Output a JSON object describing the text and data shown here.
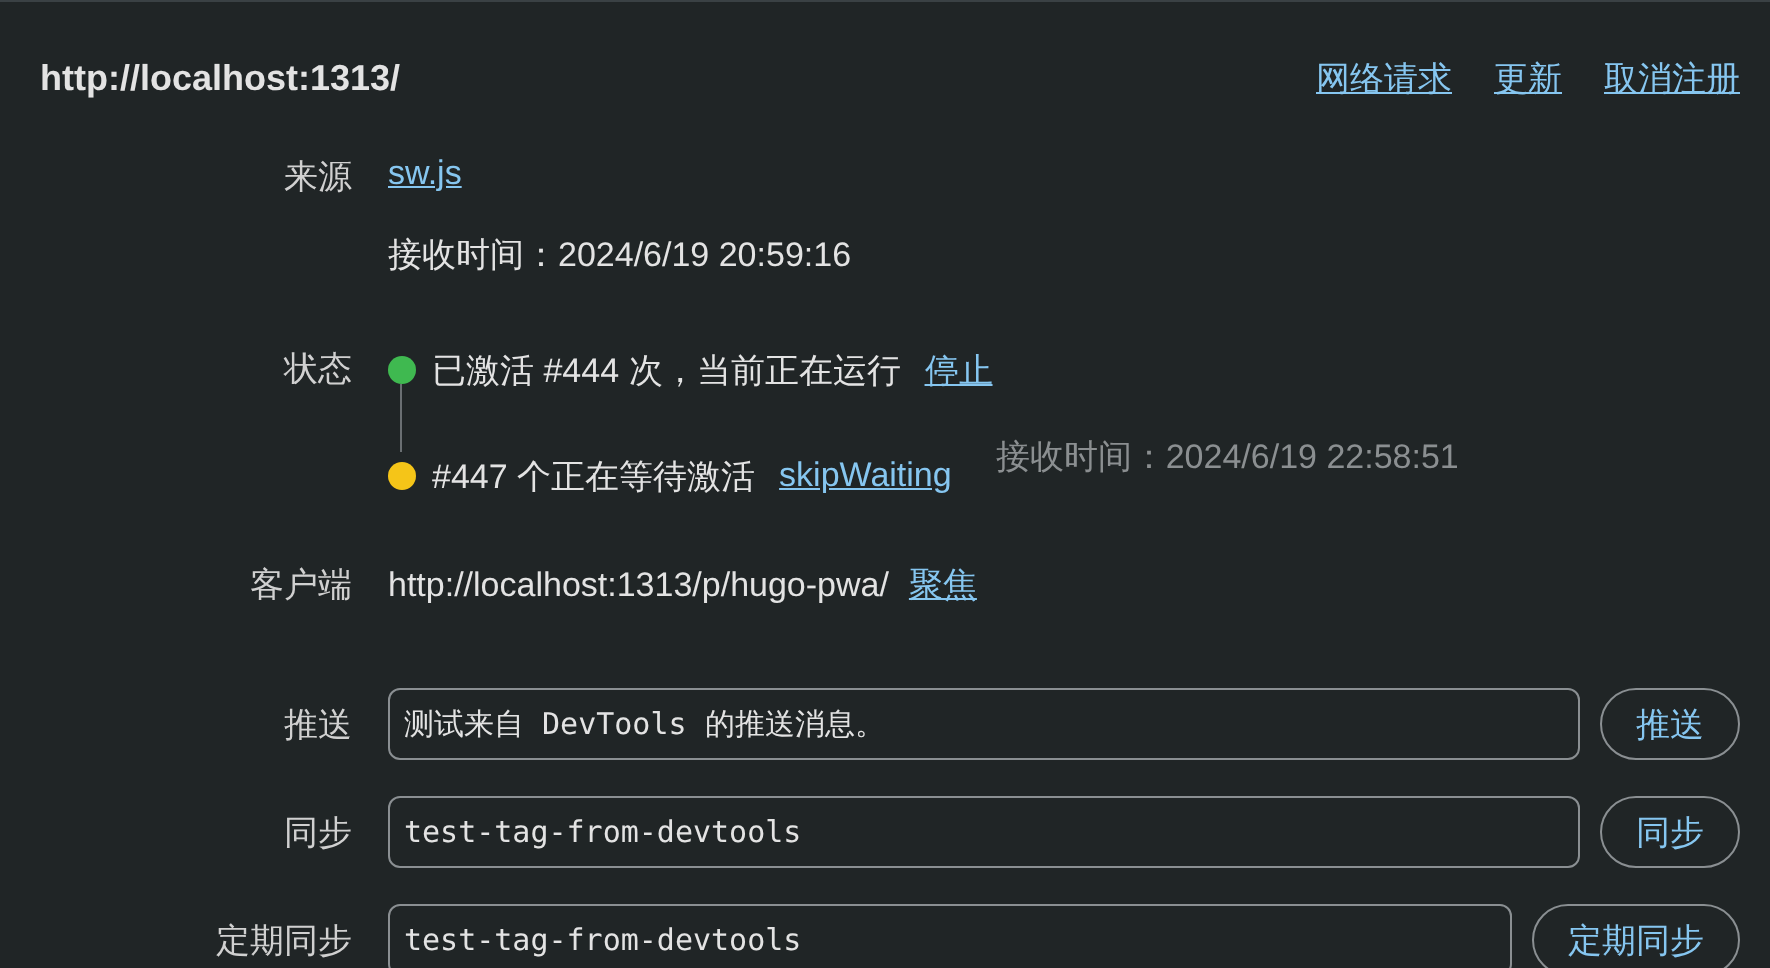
{
  "header": {
    "title": "http://localhost:1313/",
    "actions": [
      "网络请求",
      "更新",
      "取消注册"
    ]
  },
  "source": {
    "label": "来源",
    "link": "sw.js",
    "received": "接收时间：2024/6/19 20:59:16"
  },
  "status": {
    "label": "状态",
    "items": [
      {
        "text": "已激活 #444 次，当前正在运行",
        "action": "停止",
        "color": "#3fb950"
      },
      {
        "text": "#447 个正在等待激活",
        "action": "skipWaiting",
        "color": "#f5c518",
        "received": "接收时间：2024/6/19 22:58:51"
      }
    ]
  },
  "clients": {
    "label": "客户端",
    "url": "http://localhost:1313/p/hugo-pwa/",
    "action": "聚焦"
  },
  "forms": [
    {
      "label": "推送",
      "value": "测试来自 DevTools 的推送消息。",
      "button": "推送"
    },
    {
      "label": "同步",
      "value": "test-tag-from-devtools",
      "button": "同步"
    },
    {
      "label": "定期同步",
      "value": "test-tag-from-devtools",
      "button": "定期同步"
    }
  ]
}
